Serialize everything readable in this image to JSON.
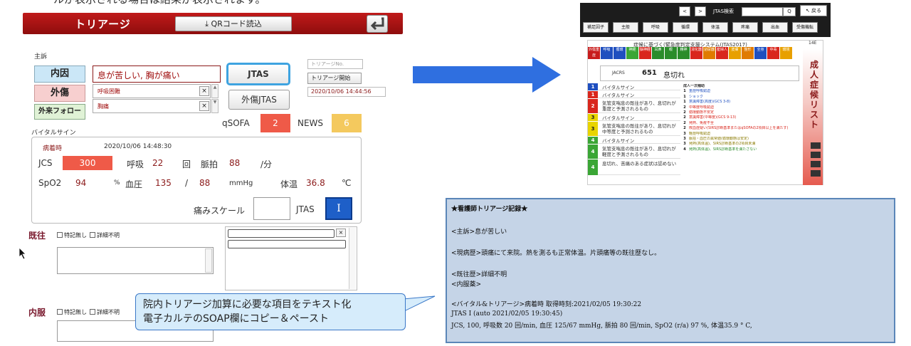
{
  "top_caption": "ールが表示される場合は結果が表示されます。",
  "triage": {
    "title": "トリアージ",
    "qr_button": "QRコード読込",
    "chief_label": "主訴",
    "naiin": "内因",
    "gaisho": "外傷",
    "follow": "外来フォロー",
    "chief_complaint": "息が苦しい, 胸が痛い",
    "select1": "呼吸困難",
    "select2": "胸痛",
    "jtas_button": "JTAS",
    "gaisho_jtas_button": "外傷JTAS",
    "triage_no_placeholder": "トリアージNo.",
    "triage_start_button": "トリアージ開始",
    "triage_start_time": "2020/10/06 14:44:56",
    "qsofa_label": "qSOFA",
    "qsofa_value": "2",
    "news_label": "NEWS",
    "news_value": "6",
    "vital_label": "バイタルサイン",
    "onset_label": "病着時",
    "onset_time": "2020/10/06 14:48:30",
    "jcs_label": "JCS",
    "jcs_value": "300",
    "resp_label": "呼吸",
    "resp_value": "22",
    "resp_unit": "回",
    "pulse_label": "脈拍",
    "pulse_value": "88",
    "pulse_unit": "/分",
    "spo2_label": "SpO2",
    "spo2_value": "94",
    "spo2_unit": "%",
    "bp_label": "血圧",
    "bp_sys": "135",
    "bp_sep": "/",
    "bp_dia": "88",
    "bp_unit": "mmHg",
    "temp_label": "体温",
    "temp_value": "36.8",
    "temp_unit": "℃",
    "pain_label": "痛みスケール",
    "jtas_label": "JTAS",
    "jtas_level": "I",
    "history_title": "既往",
    "meds_title": "内服",
    "chk_none": "特記無し",
    "chk_unknown": "詳細不明",
    "callout_line1": "院内トリアージ加算に必要な項目をテキスト化",
    "callout_line2": "電子カルテのSOAP欄にコピー＆ペースト"
  },
  "jtas_window": {
    "prev": "<",
    "next": ">",
    "search_label": "JTAS検索",
    "search_icon_char": "Q",
    "back": "戻る",
    "tabs": [
      "補足因子",
      "主般",
      "呼吸",
      "循環",
      "体温",
      "疼痛",
      "出血",
      "受傷機転"
    ],
    "header": "症候に基づく(緊急度判定支援システム(JTAS2017)",
    "corner_number": "14E",
    "code": "JACRS",
    "code_number": "651",
    "code_name": "息切れ",
    "side_text": "成人 症候リスト",
    "levels": [
      {
        "n": "1",
        "text": "バイタルサイン",
        "color": "#1f4fbf"
      },
      {
        "n": "1",
        "text": "バイタルサイン",
        "color": "#d9261c"
      },
      {
        "n": "2",
        "text": "気管支喘息の既往があり、息切れが重度と予測されるもの",
        "color": "#d9261c"
      },
      {
        "n": "3",
        "text": "バイタルサイン",
        "color": "#e8d400"
      },
      {
        "n": "3",
        "text": "気管支喘息の既往があり、息切れが中等度と予測されるもの",
        "color": "#e8d400"
      },
      {
        "n": "4",
        "text": "バイタルサイン",
        "color": "#3aa635"
      },
      {
        "n": "4",
        "text": "気管支喘息の既往があり、息切れが軽度と予測されるもの",
        "color": "#3aa635"
      },
      {
        "n": "4",
        "text": "息切れ、苦痛のある症状は認めない",
        "color": "#3aa635"
      }
    ],
    "mid_title": "成人一次補助",
    "mid_items": [
      {
        "n": "1",
        "text": "重症呼吸窮迫"
      },
      {
        "n": "1",
        "text": "ショック"
      },
      {
        "n": "1",
        "text": "意識障害(高度)(GCS 3-8)"
      },
      {
        "n": "2",
        "text": "中等度呼吸窮迫"
      },
      {
        "n": "2",
        "text": "循環動態不安定"
      },
      {
        "n": "2",
        "text": "意識障害(中等度)(GCS 9-13)"
      },
      {
        "n": "2",
        "text": "発熱、免疫不全"
      },
      {
        "n": "2",
        "text": "敗血症疑い(SIRS診断基準またはqSOFAの2項目以上を満たす)"
      },
      {
        "n": "3",
        "text": "軽症呼吸窮迫"
      },
      {
        "n": "3",
        "text": "脈拍・血圧の異常値(循環動態は安定)"
      },
      {
        "n": "3",
        "text": "発熱(高体温)、SIRS診断基準の2項目未満"
      },
      {
        "n": "4",
        "text": "発熱(高体温)、SIRS診断基準を満たさない"
      }
    ],
    "legend": [
      {
        "t": "外傷重症",
        "c": "#c81c1c"
      },
      {
        "t": "呼吸",
        "c": "#1f4fbf"
      },
      {
        "t": "循環",
        "c": "#1f4fbf"
      },
      {
        "t": "神経",
        "c": "#3aa635"
      },
      {
        "t": "脳神経",
        "c": "#d9261c"
      },
      {
        "t": "耳鼻",
        "c": "#2b8c2b"
      },
      {
        "t": "眼",
        "c": "#2b8c2b"
      },
      {
        "t": "精神",
        "c": "#2b8c2b"
      },
      {
        "t": "消化器",
        "c": "#d9261c"
      },
      {
        "t": "泌尿器",
        "c": "#e07b00"
      },
      {
        "t": "産婦人",
        "c": "#d9261c"
      },
      {
        "t": "皮膚",
        "c": "#e8a000"
      },
      {
        "t": "整形",
        "c": "#e07b00"
      },
      {
        "t": "全身",
        "c": "#1f4fbf"
      },
      {
        "t": "中毒",
        "c": "#d9261c"
      },
      {
        "t": "環境",
        "c": "#e8a000"
      }
    ]
  },
  "record": {
    "title": "★看護師トリアージ記録★",
    "chief": "<主訴>息が苦しい",
    "present": "<現病歴>頭痛にて来院。熱を測るも正常体温。片頭痛等の既往歴なし。",
    "past": "<既往歴>詳細不明",
    "meds": "<内服薬>",
    "vitals_head": "<バイタル&トリアージ>病着時 取得時刻:2021/02/05 19:30:22",
    "jtas_line": "JTAS I (auto 2021/02/05 19:30:45)",
    "vital_line": "JCS, 100, 呼吸数 20 回/min, 血圧 125/67 mmHg, 脈拍 80 回/min, SpO2 (r/a) 97 %, 体温35.9 ° C,"
  },
  "colors": {
    "triage_red": "#a01010",
    "jtas_highlight": "#3ea3e0",
    "arrow": "#2f6fe0",
    "record_bg": "#c5d4e7"
  }
}
